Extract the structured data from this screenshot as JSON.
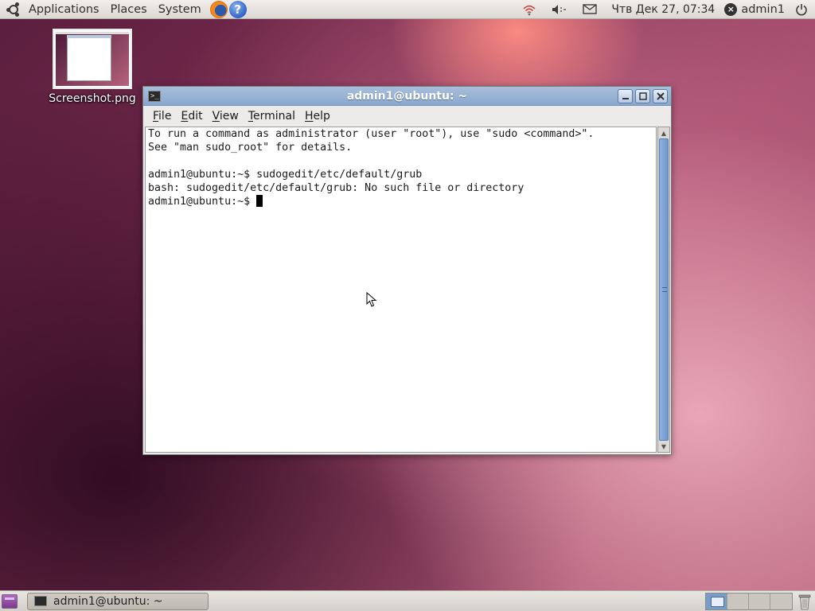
{
  "top_panel": {
    "menus": [
      "Applications",
      "Places",
      "System"
    ],
    "clock": "Чтв Дек 27, 07:34",
    "user": "admin1",
    "launchers": [
      "firefox-icon",
      "help-icon"
    ],
    "tray_icons": [
      "network-icon",
      "volume-icon",
      "mail-icon",
      "user-status-icon",
      "power-icon"
    ],
    "help_glyph": "?"
  },
  "desktop": {
    "icons": [
      {
        "label": "Screenshot.png",
        "icon": "image-thumbnail"
      }
    ]
  },
  "terminal": {
    "title": "admin1@ubuntu: ~",
    "menu": [
      {
        "accel": "F",
        "rest": "ile"
      },
      {
        "accel": "E",
        "rest": "dit"
      },
      {
        "accel": "V",
        "rest": "iew"
      },
      {
        "accel": "T",
        "rest": "erminal"
      },
      {
        "accel": "H",
        "rest": "elp"
      }
    ],
    "lines": [
      "To run a command as administrator (user \"root\"), use \"sudo <command>\".",
      "See \"man sudo_root\" for details.",
      "",
      "admin1@ubuntu:~$ sudogedit/etc/default/grub",
      "bash: sudogedit/etc/default/grub: No such file or directory"
    ],
    "prompt": "admin1@ubuntu:~$ "
  },
  "bottom_panel": {
    "task_label": "admin1@ubuntu: ~",
    "workspace_count": 4,
    "active_workspace": 1
  }
}
